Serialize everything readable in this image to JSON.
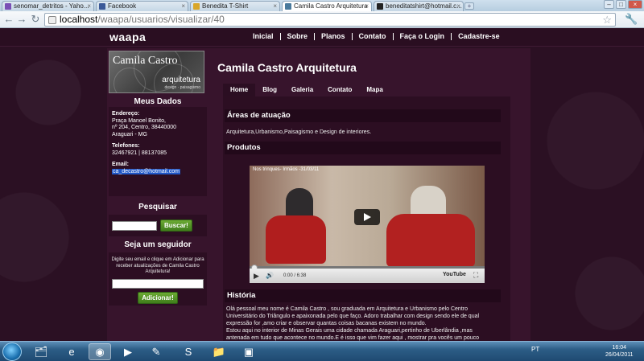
{
  "browser": {
    "tabs": [
      {
        "label": "senomar_detritos - Yaho...",
        "active": false,
        "color": "#7a4fb5"
      },
      {
        "label": "Facebook",
        "active": false,
        "color": "#3b5998"
      },
      {
        "label": "Benedita T-Shirt",
        "active": false,
        "color": "#d9a629"
      },
      {
        "label": "Camila Castro Arquitetura",
        "active": true,
        "color": "#4a7a9c"
      },
      {
        "label": "beneditatshirt@hotmail.c...",
        "active": false,
        "color": "#222222"
      }
    ],
    "url_host": "localhost",
    "url_path": "/waapa/usuarios/visualizar/40"
  },
  "site": {
    "logo": "waapa",
    "nav": [
      "Inicial",
      "Sobre",
      "Planos",
      "Contato",
      "Faça o Login",
      "Cadastre-se"
    ]
  },
  "sidebar": {
    "banner_name": "Camila Castro",
    "banner_sub": "arquitetura",
    "banner_sub2": "design · paisagismo",
    "meus_dados_title": "Meus Dados",
    "endereco_label": "Endereço:",
    "endereco_1": "Praça Manoel Bonito,",
    "endereco_2": "nº 204, Centro, 38440000",
    "endereco_3": "Araguari - MG",
    "telefones_label": "Telefones:",
    "telefones": "32467921 | 88137085",
    "email_label": "Email:",
    "email": "ca_decastro@hotmail.com",
    "pesquisar_title": "Pesquisar",
    "buscar_button": "Buscar!",
    "seguidor_title": "Seja um seguidor",
    "seguidor_text": "Digite seu email e clique em Adicionar para receber atualizações de Camila Castro Arquitetura!",
    "adicionar_button": "Adicionar!"
  },
  "main": {
    "title": "Camila Castro Arquitetura",
    "tabs": [
      "Home",
      "Blog",
      "Galeria",
      "Contato",
      "Mapa"
    ],
    "areas_title": "Áreas de atuação",
    "areas_text": "Arquitetura,Urbanismo,Paisagismo e Design de interiores.",
    "produtos_title": "Produtos",
    "video_title": "Nos trinques- Irmãos -31/03/11",
    "video_time": "0:00 / 6:38",
    "video_logo": "YouTube",
    "historia_title": "História",
    "historia_lines": [
      "Olá pessoal meu nome é Camila Castro , sou graduada em Arquitetura e Urbanismo pelo Centro",
      "Universitário do Triângulo e apaixonada pelo que faço. Adoro trabalhar com design sendo ele de qual",
      "expressão for ,amo criar e observar quantas coisas bacanas existem no mundo.",
      "Estou aqui no interior de Minas Gerais uma cidade chamada Araguari,pertinho de Uberlândia ,mas",
      "antenada em tudo que acontece no mundo.E é isso que vim fazer aqui , mostrar pra vocês um pouco"
    ]
  },
  "taskbar": {
    "lang": "PT",
    "time": "16:04",
    "date": "26/04/2011"
  }
}
